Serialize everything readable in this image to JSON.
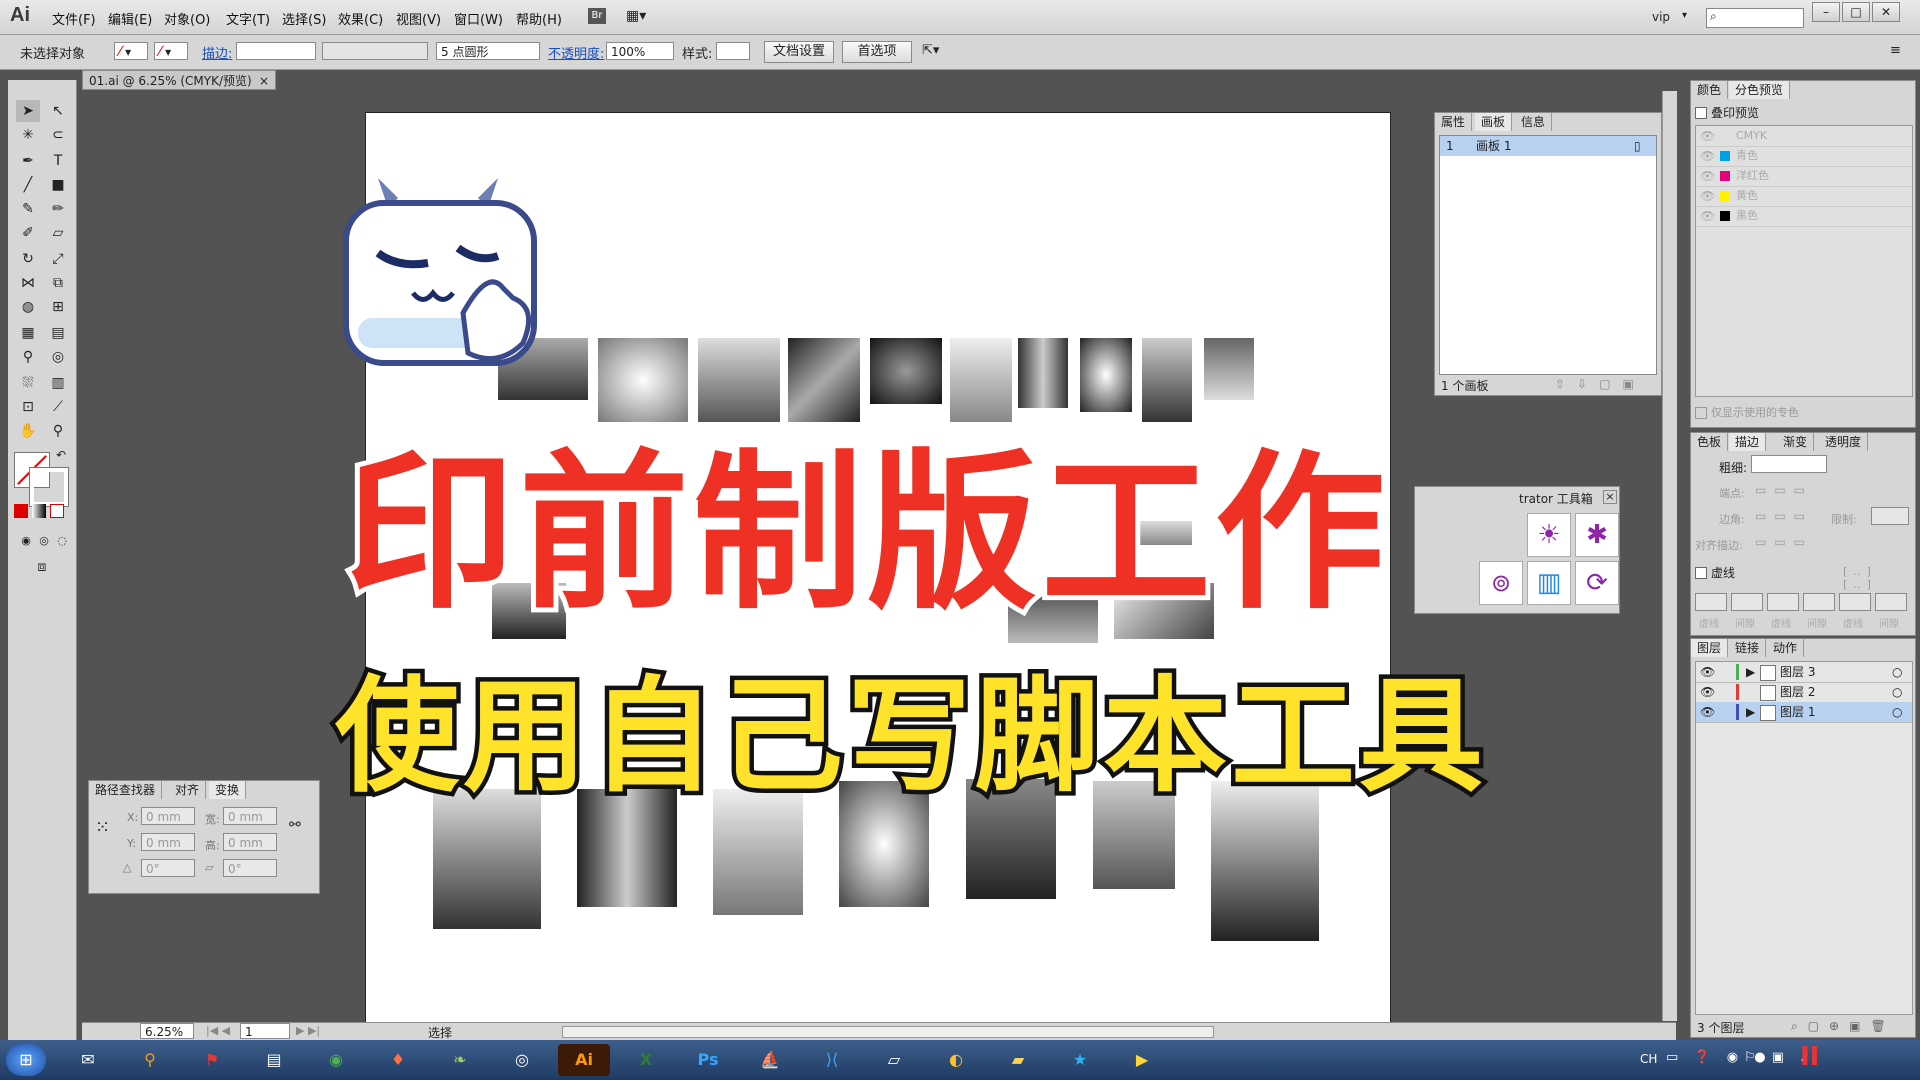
{
  "menubar": {
    "logo": "Ai",
    "items": [
      "文件(F)",
      "编辑(E)",
      "对象(O)",
      "文字(T)",
      "选择(S)",
      "效果(C)",
      "视图(V)",
      "窗口(W)",
      "帮助(H)"
    ],
    "bridge": "Br",
    "user": "vip",
    "search_icon": "search-icon"
  },
  "controlbar": {
    "selection": "未选择对象",
    "stroke_label": "描边:",
    "brush": "5 点圆形",
    "opacity_label": "不透明度:",
    "opacity": "100%",
    "style_label": "样式:",
    "doc_setup": "文档设置",
    "prefs": "首选项"
  },
  "document": {
    "tab": "01.ai @ 6.25% (CMYK/预览)",
    "zoom": "6.25%",
    "page": "1",
    "status": "选择"
  },
  "overlay": {
    "title1": "印前制版工作",
    "title2": "使用自己写脚本工具"
  },
  "artboards_panel": {
    "tabs": [
      "属性",
      "画板",
      "信息"
    ],
    "row_index": "1",
    "row_name": "画板 1",
    "footer": "1 个画板"
  },
  "separations_panel": {
    "tabs": [
      "颜色",
      "分色预览"
    ],
    "overprint": "叠印预览",
    "inks": [
      {
        "name": "CMYK",
        "color": "#bbbbbb"
      },
      {
        "name": "青色",
        "color": "#00a0e9"
      },
      {
        "name": "洋红色",
        "color": "#e4007f"
      },
      {
        "name": "黄色",
        "color": "#fff100"
      },
      {
        "name": "黑色",
        "color": "#000000"
      }
    ],
    "used_only": "仅显示使用的专色"
  },
  "stroke_panel": {
    "tabs": [
      "色板",
      "描边",
      "渐变",
      "透明度"
    ],
    "weight_label": "粗细:",
    "cap_label": "端点:",
    "corner_label": "边角:",
    "limit_label": "限制:",
    "align_label": "对齐描边:",
    "dashed_label": "虚线",
    "dash_fields": [
      "虚线",
      "间隙",
      "虚线",
      "间隙",
      "虚线",
      "间隙"
    ]
  },
  "script_panel": {
    "title": "trator 工具箱"
  },
  "layers_panel": {
    "tabs": [
      "图层",
      "链接",
      "动作"
    ],
    "layers": [
      {
        "name": "图层 3",
        "color": "#4caf50"
      },
      {
        "name": "图层 2",
        "color": "#e53935"
      },
      {
        "name": "图层 1",
        "color": "#3f51b5"
      }
    ],
    "footer": "3 个图层"
  },
  "transform_panel": {
    "tabs": [
      "路径查找器",
      "对齐",
      "变换"
    ],
    "x_label": "X:",
    "x": "0 mm",
    "w_label": "宽:",
    "w": "0 mm",
    "y_label": "Y:",
    "y": "0 mm",
    "h_label": "高:",
    "h": "0 mm",
    "rot": "0°",
    "shear": "0°"
  },
  "taskbar": {
    "ime": "CH"
  }
}
